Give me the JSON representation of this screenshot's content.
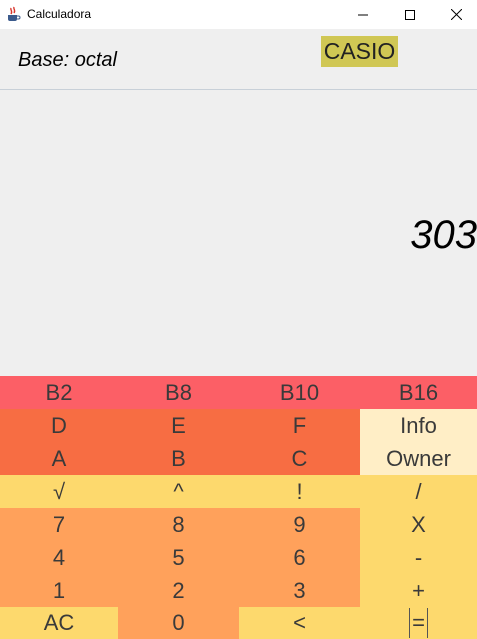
{
  "window": {
    "title": "Calculadora",
    "app_icon": "java-cup-icon",
    "controls": [
      "minimize-icon",
      "maximize-icon",
      "close-icon"
    ]
  },
  "header": {
    "base_label": "Base: octal",
    "brand": "CASIO"
  },
  "display": {
    "value": "303"
  },
  "colors": {
    "base_keys": "#fc5f66",
    "hex_keys": "#f76d43",
    "info_keys": "#ffeec6",
    "operator_keys": "#fdd96d",
    "digit_keys": "#ffa15b",
    "brand_bg": "#d0c754"
  },
  "keypad": {
    "bases": [
      "B2",
      "B8",
      "B10",
      "B16"
    ],
    "row_d": [
      "D",
      "E",
      "F",
      "Info"
    ],
    "row_a": [
      "A",
      "B",
      "C",
      "Owner"
    ],
    "row_ops": [
      "√",
      "^",
      "!",
      "/"
    ],
    "row_7": [
      "7",
      "8",
      "9",
      "X"
    ],
    "row_4": [
      "4",
      "5",
      "6",
      "-"
    ],
    "row_1": [
      "1",
      "2",
      "3",
      "+"
    ],
    "row_0": [
      "AC",
      "0",
      "<",
      "="
    ]
  }
}
